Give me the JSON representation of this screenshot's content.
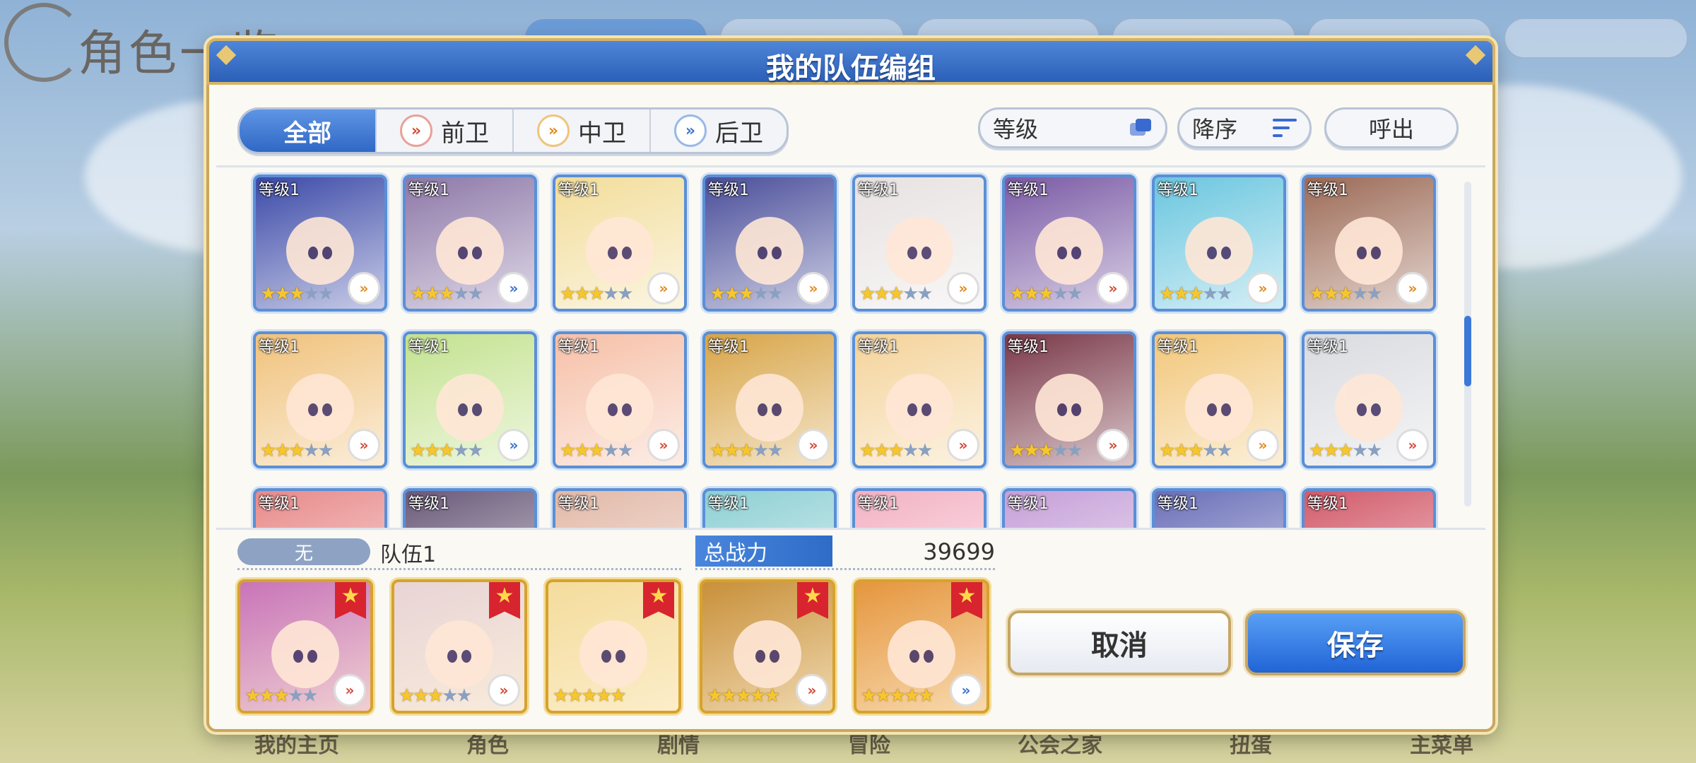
{
  "background": {
    "screen_title": "角色一览",
    "bottom_nav": [
      "我的主页",
      "角色",
      "剧情",
      "冒险",
      "公会之家",
      "扭蛋",
      "主菜单"
    ]
  },
  "dialog": {
    "title": "我的队伍编组",
    "filter_tabs": [
      {
        "label": "全部",
        "role": null,
        "active": true
      },
      {
        "label": "前卫",
        "role": "front",
        "active": false
      },
      {
        "label": "中卫",
        "role": "mid",
        "active": false
      },
      {
        "label": "后卫",
        "role": "back",
        "active": false
      }
    ],
    "sort_level_label": "等级",
    "sort_order_label": "降序",
    "call_out_label": "呼出",
    "colors": {
      "accent": "#2f68c6",
      "frame_gold": "#c8a75c",
      "card_blue": "#5a8fd6"
    },
    "characters": [
      {
        "level": "等级1",
        "stars": 3,
        "max_stars": 5,
        "role": "mid",
        "color": "#3c4aa8"
      },
      {
        "level": "等级1",
        "stars": 3,
        "max_stars": 5,
        "role": "back",
        "color": "#8d78a8"
      },
      {
        "level": "等级1",
        "stars": 3,
        "max_stars": 5,
        "role": "mid",
        "color": "#f2dd9a"
      },
      {
        "level": "等级1",
        "stars": 3,
        "max_stars": 5,
        "role": "mid",
        "color": "#4a4e9a"
      },
      {
        "level": "等级1",
        "stars": 3,
        "max_stars": 5,
        "role": "mid",
        "color": "#e8e2e2"
      },
      {
        "level": "等级1",
        "stars": 3,
        "max_stars": 5,
        "role": "front",
        "color": "#7a5aa5"
      },
      {
        "level": "等级1",
        "stars": 3,
        "max_stars": 5,
        "role": "mid",
        "color": "#6ac6df"
      },
      {
        "level": "等级1",
        "stars": 3,
        "max_stars": 5,
        "role": "mid",
        "color": "#9c6a56"
      },
      {
        "level": "等级1",
        "stars": 3,
        "max_stars": 5,
        "role": "front",
        "color": "#f0c27c"
      },
      {
        "level": "等级1",
        "stars": 3,
        "max_stars": 5,
        "role": "back",
        "color": "#c3e28f"
      },
      {
        "level": "等级1",
        "stars": 3,
        "max_stars": 5,
        "role": "front",
        "color": "#f6c0a8"
      },
      {
        "level": "等级1",
        "stars": 3,
        "max_stars": 5,
        "role": "front",
        "color": "#d8a548"
      },
      {
        "level": "等级1",
        "stars": 3,
        "max_stars": 5,
        "role": "front",
        "color": "#f4d39a"
      },
      {
        "level": "等级1",
        "stars": 3,
        "max_stars": 5,
        "role": "front",
        "color": "#7a3848"
      },
      {
        "level": "等级1",
        "stars": 3,
        "max_stars": 5,
        "role": "mid",
        "color": "#f2c77a"
      },
      {
        "level": "等级1",
        "stars": 3,
        "max_stars": 5,
        "role": "front",
        "color": "#dadbe0"
      },
      {
        "level": "等级1",
        "stars": 0,
        "max_stars": 5,
        "role": null,
        "color": "#e88a8a"
      },
      {
        "level": "等级1",
        "stars": 0,
        "max_stars": 5,
        "role": null,
        "color": "#6a5a7a"
      },
      {
        "level": "等级1",
        "stars": 0,
        "max_stars": 5,
        "role": null,
        "color": "#e2b9a8"
      },
      {
        "level": "等级1",
        "stars": 0,
        "max_stars": 5,
        "role": null,
        "color": "#8ed0d4"
      },
      {
        "level": "等级1",
        "stars": 0,
        "max_stars": 5,
        "role": null,
        "color": "#f3b2c4"
      },
      {
        "level": "等级1",
        "stars": 0,
        "max_stars": 5,
        "role": null,
        "color": "#c6a0d8"
      },
      {
        "level": "等级1",
        "stars": 0,
        "max_stars": 5,
        "role": null,
        "color": "#6a6fb8"
      },
      {
        "level": "等级1",
        "stars": 0,
        "max_stars": 5,
        "role": null,
        "color": "#d25a6a"
      }
    ],
    "team": {
      "slot_label": "无",
      "name": "队伍1",
      "power_label": "总战力",
      "power_value": "39699",
      "members": [
        {
          "stars": 3,
          "max_stars": 5,
          "role": "front",
          "color": "#c874b8"
        },
        {
          "stars": 3,
          "max_stars": 5,
          "role": "front",
          "color": "#e8d4d6"
        },
        {
          "stars": 5,
          "max_stars": 5,
          "role": null,
          "color": "#f4dc9c"
        },
        {
          "stars": 5,
          "max_stars": 5,
          "role": "front",
          "color": "#c8903a"
        },
        {
          "stars": 5,
          "max_stars": 5,
          "role": "back",
          "color": "#e5963e"
        }
      ]
    },
    "cancel_label": "取消",
    "save_label": "保存"
  }
}
